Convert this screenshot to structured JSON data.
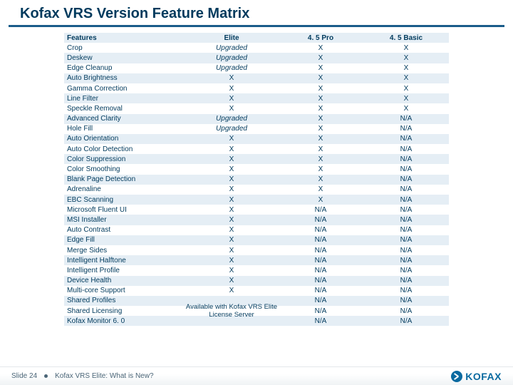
{
  "title": "Kofax VRS Version Feature Matrix",
  "columns": [
    "Features",
    "Elite",
    "4. 5 Pro",
    "4. 5 Basic"
  ],
  "rows": [
    {
      "feature": "Crop",
      "elite": "Upgraded",
      "pro": "X",
      "basic": "X"
    },
    {
      "feature": "Deskew",
      "elite": "Upgraded",
      "pro": "X",
      "basic": "X"
    },
    {
      "feature": "Edge Cleanup",
      "elite": "Upgraded",
      "pro": "X",
      "basic": "X"
    },
    {
      "feature": "Auto Brightness",
      "elite": "X",
      "pro": "X",
      "basic": "X"
    },
    {
      "feature": "Gamma Correction",
      "elite": "X",
      "pro": "X",
      "basic": "X"
    },
    {
      "feature": "Line Filter",
      "elite": "X",
      "pro": "X",
      "basic": "X"
    },
    {
      "feature": "Speckle Removal",
      "elite": "X",
      "pro": "X",
      "basic": "X"
    },
    {
      "feature": "Advanced Clarity",
      "elite": "Upgraded",
      "pro": "X",
      "basic": "N/A"
    },
    {
      "feature": "Hole Fill",
      "elite": "Upgraded",
      "pro": "X",
      "basic": "N/A"
    },
    {
      "feature": "Auto Orientation",
      "elite": "X",
      "pro": "X",
      "basic": "N/A"
    },
    {
      "feature": "Auto Color Detection",
      "elite": "X",
      "pro": "X",
      "basic": "N/A"
    },
    {
      "feature": "Color Suppression",
      "elite": "X",
      "pro": "X",
      "basic": "N/A"
    },
    {
      "feature": "Color Smoothing",
      "elite": "X",
      "pro": "X",
      "basic": "N/A"
    },
    {
      "feature": "Blank Page Detection",
      "elite": "X",
      "pro": "X",
      "basic": "N/A"
    },
    {
      "feature": "Adrenaline",
      "elite": "X",
      "pro": "X",
      "basic": "N/A"
    },
    {
      "feature": "EBC Scanning",
      "elite": "X",
      "pro": "X",
      "basic": "N/A"
    },
    {
      "feature": "Microsoft Fluent UI",
      "elite": "X",
      "pro": "N/A",
      "basic": "N/A"
    },
    {
      "feature": "MSI Installer",
      "elite": "X",
      "pro": "N/A",
      "basic": "N/A"
    },
    {
      "feature": "Auto Contrast",
      "elite": "X",
      "pro": "N/A",
      "basic": "N/A"
    },
    {
      "feature": "Edge Fill",
      "elite": "X",
      "pro": "N/A",
      "basic": "N/A"
    },
    {
      "feature": "Merge Sides",
      "elite": "X",
      "pro": "N/A",
      "basic": "N/A"
    },
    {
      "feature": "Intelligent Halftone",
      "elite": "X",
      "pro": "N/A",
      "basic": "N/A"
    },
    {
      "feature": "Intelligent Profile",
      "elite": "X",
      "pro": "N/A",
      "basic": "N/A"
    },
    {
      "feature": "Device Health",
      "elite": "X",
      "pro": "N/A",
      "basic": "N/A"
    },
    {
      "feature": "Multi-core Support",
      "elite": "X",
      "pro": "N/A",
      "basic": "N/A"
    },
    {
      "feature": "Shared Profiles",
      "elite": "",
      "pro": "N/A",
      "basic": "N/A"
    },
    {
      "feature": "Shared Licensing",
      "elite": "",
      "pro": "N/A",
      "basic": "N/A"
    },
    {
      "feature": "Kofax Monitor 6. 0",
      "elite": "",
      "pro": "N/A",
      "basic": "N/A"
    }
  ],
  "elite_merged_note": "Available with Kofax VRS Elite License Server",
  "footer": {
    "slide": "Slide 24",
    "text": "Kofax VRS Elite: What is New?",
    "logo": "KOFAX"
  }
}
